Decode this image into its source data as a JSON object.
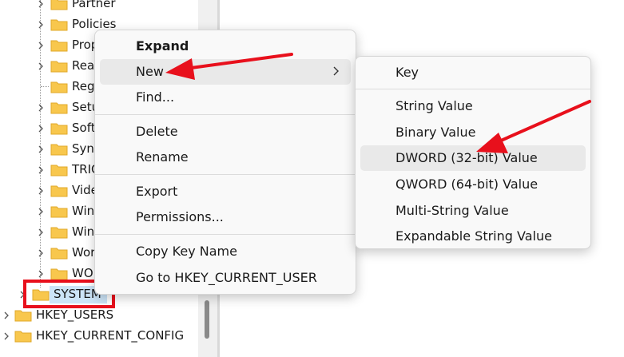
{
  "tree": {
    "items": [
      {
        "label": "Partner"
      },
      {
        "label": "Policies"
      },
      {
        "label": "Prop"
      },
      {
        "label": "Rea"
      },
      {
        "label": "Reg"
      },
      {
        "label": "Setu"
      },
      {
        "label": "Soft"
      },
      {
        "label": "Sync"
      },
      {
        "label": "TRIC"
      },
      {
        "label": "Vide"
      },
      {
        "label": "Win"
      },
      {
        "label": "Win"
      },
      {
        "label": "Wor"
      },
      {
        "label": "WO"
      },
      {
        "label": "SYSTEM"
      },
      {
        "label": "HKEY_USERS"
      },
      {
        "label": "HKEY_CURRENT_CONFIG"
      }
    ]
  },
  "context_menu": {
    "expand": "Expand",
    "new": "New",
    "find": "Find...",
    "delete": "Delete",
    "rename": "Rename",
    "export": "Export",
    "permissions": "Permissions...",
    "copy_key_name": "Copy Key Name",
    "go_to": "Go to HKEY_CURRENT_USER"
  },
  "submenu": {
    "key": "Key",
    "string_value": "String Value",
    "binary_value": "Binary Value",
    "dword_value": "DWORD (32-bit) Value",
    "qword_value": "QWORD (64-bit) Value",
    "multi_string_value": "Multi-String Value",
    "expandable_string_value": "Expandable String Value"
  },
  "colors": {
    "annotation_red": "#e8101c",
    "folder_yellow": "#f8c74d",
    "selection_blue": "#cce4f7"
  }
}
